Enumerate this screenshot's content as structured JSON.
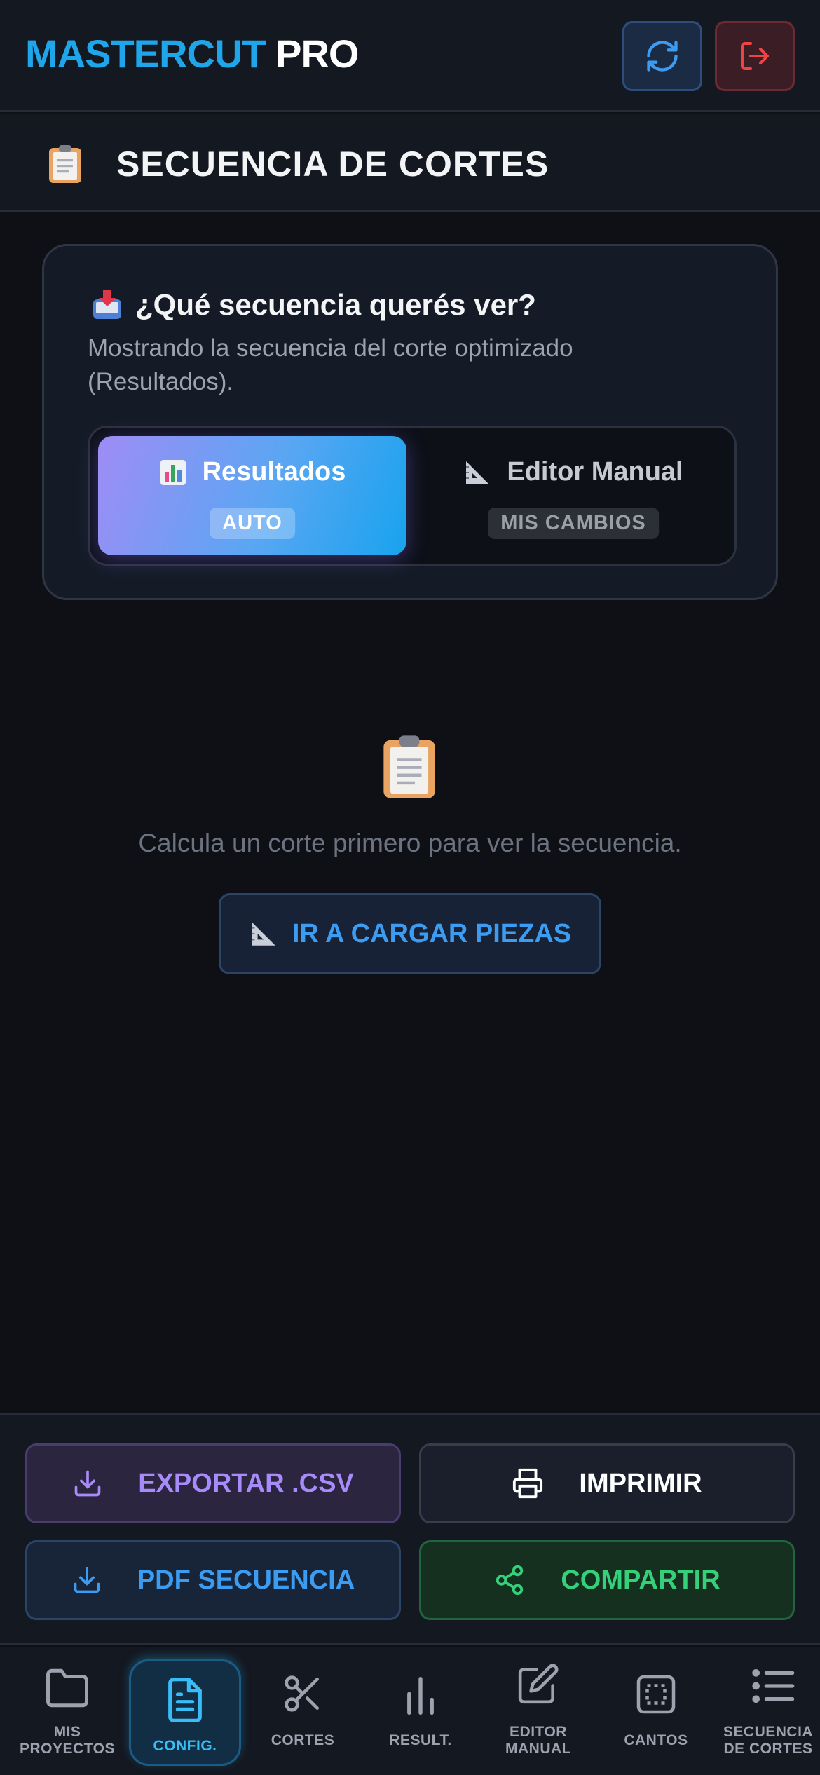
{
  "header": {
    "brand_primary": "MASTERCUT",
    "brand_secondary": "PRO",
    "refresh_icon": "refresh-icon",
    "logout_icon": "logout-icon"
  },
  "section": {
    "icon": "clipboard-icon",
    "title": "SECUENCIA DE CORTES"
  },
  "selector": {
    "question_icon": "inbox-download-icon",
    "question": "¿Qué secuencia querés ver?",
    "description": "Mostrando la secuencia del corte optimizado (Resultados).",
    "options": [
      {
        "label": "Resultados",
        "tag": "AUTO",
        "icon": "bar-chart-icon",
        "active": true
      },
      {
        "label": "Editor Manual",
        "tag": "MIS CAMBIOS",
        "icon": "triangle-ruler-icon",
        "active": false
      }
    ]
  },
  "empty_state": {
    "icon": "clipboard-icon",
    "message": "Calcula un corte primero para ver la secuencia.",
    "button_label": "IR A CARGAR PIEZAS",
    "button_icon": "triangle-ruler-icon"
  },
  "actions": {
    "export_csv": "EXPORTAR .CSV",
    "print": "IMPRIMIR",
    "pdf": "PDF SECUENCIA",
    "share": "COMPARTIR"
  },
  "colors": {
    "accent": "#1ea5ea",
    "csv": "#a78bfa",
    "pdf": "#3b9cf2",
    "share": "#34d17a",
    "logout": "#ef4444"
  },
  "nav": {
    "items": [
      {
        "l1": "MIS",
        "l2": "PROYECTOS",
        "icon": "folder-icon"
      },
      {
        "l1": "CONFIG.",
        "l2": "",
        "icon": "document-icon",
        "active": true
      },
      {
        "l1": "CORTES",
        "l2": "",
        "icon": "scissors-icon"
      },
      {
        "l1": "RESULT.",
        "l2": "",
        "icon": "bar-chart-icon"
      },
      {
        "l1": "EDITOR",
        "l2": "MANUAL",
        "icon": "edit-icon"
      },
      {
        "l1": "CANTOS",
        "l2": "",
        "icon": "frame-icon"
      },
      {
        "l1": "SECUENCIA",
        "l2": "DE CORTES",
        "icon": "list-icon"
      }
    ]
  }
}
